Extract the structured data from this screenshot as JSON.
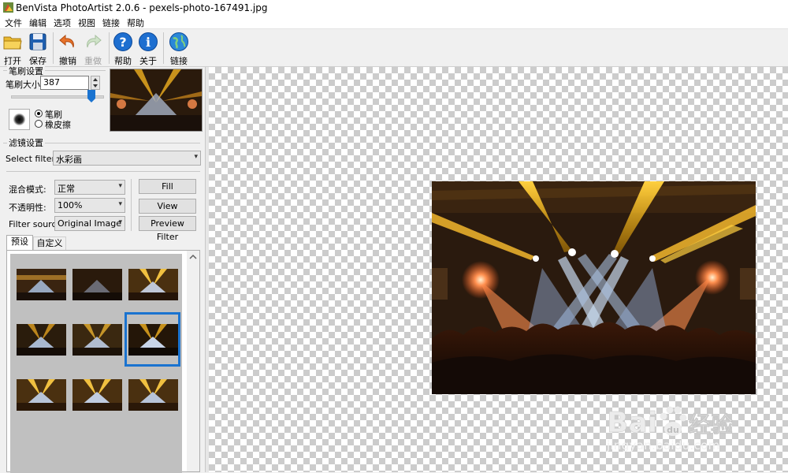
{
  "window": {
    "title": "BenVista PhotoArtist 2.0.6 - pexels-photo-167491.jpg"
  },
  "menu": [
    "文件",
    "编辑",
    "选项",
    "视图",
    "链接",
    "帮助"
  ],
  "toolbar": {
    "open": "打开",
    "save": "保存",
    "undo": "撤销",
    "redo": "重做",
    "help": "帮助",
    "about": "关于",
    "link": "链接"
  },
  "brush": {
    "group_title": "笔刷设置",
    "size_label": "笔刷大小:",
    "size_value": "387",
    "mode_brush": "笔刷",
    "mode_eraser": "橡皮擦",
    "selected_mode": "笔刷"
  },
  "filter": {
    "group_title": "滤镜设置",
    "select_label": "Select filter:",
    "selected_filter": "水彩画",
    "blend_label": "混合模式:",
    "blend_value": "正常",
    "opacity_label": "不透明性:",
    "opacity_value": "100%",
    "source_label": "Filter source:",
    "source_value": "Original Image",
    "fill_button": "Fill",
    "view_original_button": "View Original",
    "preview_button": "Preview Filter"
  },
  "tabs": [
    "预设",
    "自定义"
  ],
  "active_tab": "预设",
  "presets": {
    "count": 9,
    "selected_index": 5
  },
  "watermark": {
    "brand_latin": "Bai",
    "brand_latin_2": "du",
    "brand_cn": "经验",
    "url": "jingyan.baidu.com"
  },
  "colors": {
    "selection": "#1a73d0",
    "icon_blue": "#1e6fd0",
    "undo_orange": "#e8732a"
  }
}
